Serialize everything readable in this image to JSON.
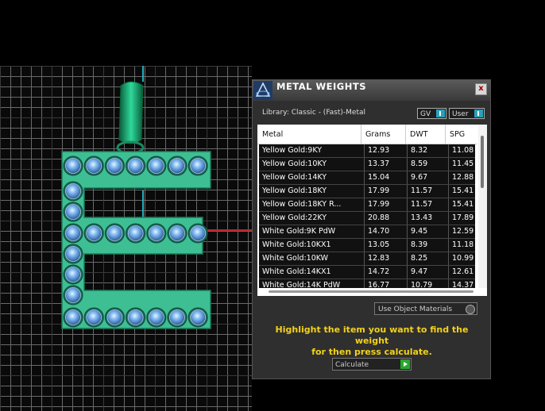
{
  "panel": {
    "title": "METAL WEIGHTS",
    "close_label": "x",
    "library_label": "Library: Classic - (Fast)-Metal",
    "toggles": {
      "gv": "GV",
      "user": "User"
    },
    "table": {
      "headers": [
        "Metal",
        "Grams",
        "DWT",
        "SPG"
      ],
      "rows": [
        [
          "Yellow Gold:9KY",
          "12.93",
          "8.32",
          "11.08"
        ],
        [
          "Yellow Gold:10KY",
          "13.37",
          "8.59",
          "11.45"
        ],
        [
          "Yellow Gold:14KY",
          "15.04",
          "9.67",
          "12.88"
        ],
        [
          "Yellow Gold:18KY",
          "17.99",
          "11.57",
          "15.41"
        ],
        [
          "Yellow Gold:18KY R...",
          "17.99",
          "11.57",
          "15.41"
        ],
        [
          "Yellow Gold:22KY",
          "20.88",
          "13.43",
          "17.89"
        ],
        [
          "White Gold:9K PdW",
          "14.70",
          "9.45",
          "12.59"
        ],
        [
          "White Gold:10KX1",
          "13.05",
          "8.39",
          "11.18"
        ],
        [
          "White Gold:10KW",
          "12.83",
          "8.25",
          "10.99"
        ],
        [
          "White Gold:14KX1",
          "14.72",
          "9.47",
          "12.61"
        ],
        [
          "White Gold:14K PdW",
          "16.77",
          "10.79",
          "14.37"
        ]
      ]
    },
    "use_object_materials": "Use Object Materials",
    "hint_line1": "Highlight the item you want to find the weight",
    "hint_line2": "for then press calculate.",
    "calculate_label": "Calculate"
  },
  "colors": {
    "letter": "#3dbf93",
    "gem": "#6aa8e8",
    "hint": "#f2d21a",
    "title_bar": "#4a4a4a"
  }
}
